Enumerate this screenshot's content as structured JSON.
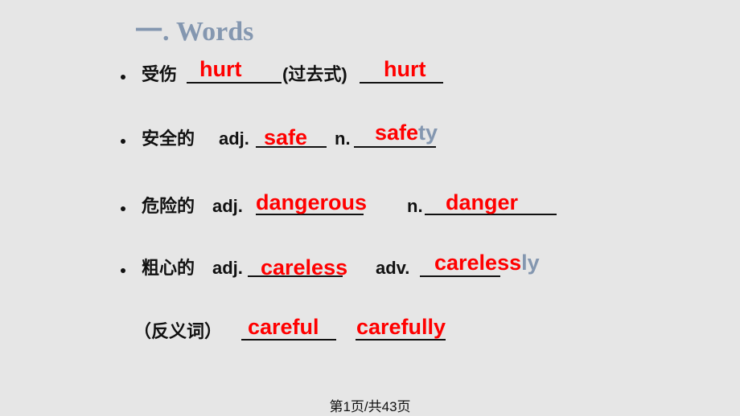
{
  "slide": {
    "title": "一. Words",
    "items": [
      {
        "prompt": "受伤",
        "middle_label": "(过去式)",
        "answer1": "hurt",
        "answer2": "hurt"
      },
      {
        "prompt": "安全的",
        "label1": "adj.",
        "label2": "n.",
        "answer1": "safe",
        "answer2_main": "safe",
        "answer2_hint": "ty"
      },
      {
        "prompt": "危险的",
        "label1": "adj.",
        "label2": "n.",
        "answer1": "dangerous",
        "answer2": "danger"
      },
      {
        "prompt": "粗心的",
        "label1": "adj.",
        "label2": "adv.",
        "answer1": "careless",
        "answer2_main": "careless",
        "answer2_hint": "ly"
      },
      {
        "prompt": "（反义词）",
        "answer1": "careful",
        "answer2": "carefully"
      }
    ],
    "colors": {
      "answer": "#ff0000",
      "hint": "#8497b0",
      "title": "#8497b0",
      "background": "#e6e6e6"
    }
  },
  "footer": {
    "page_indicator": "第1页/共43页"
  }
}
